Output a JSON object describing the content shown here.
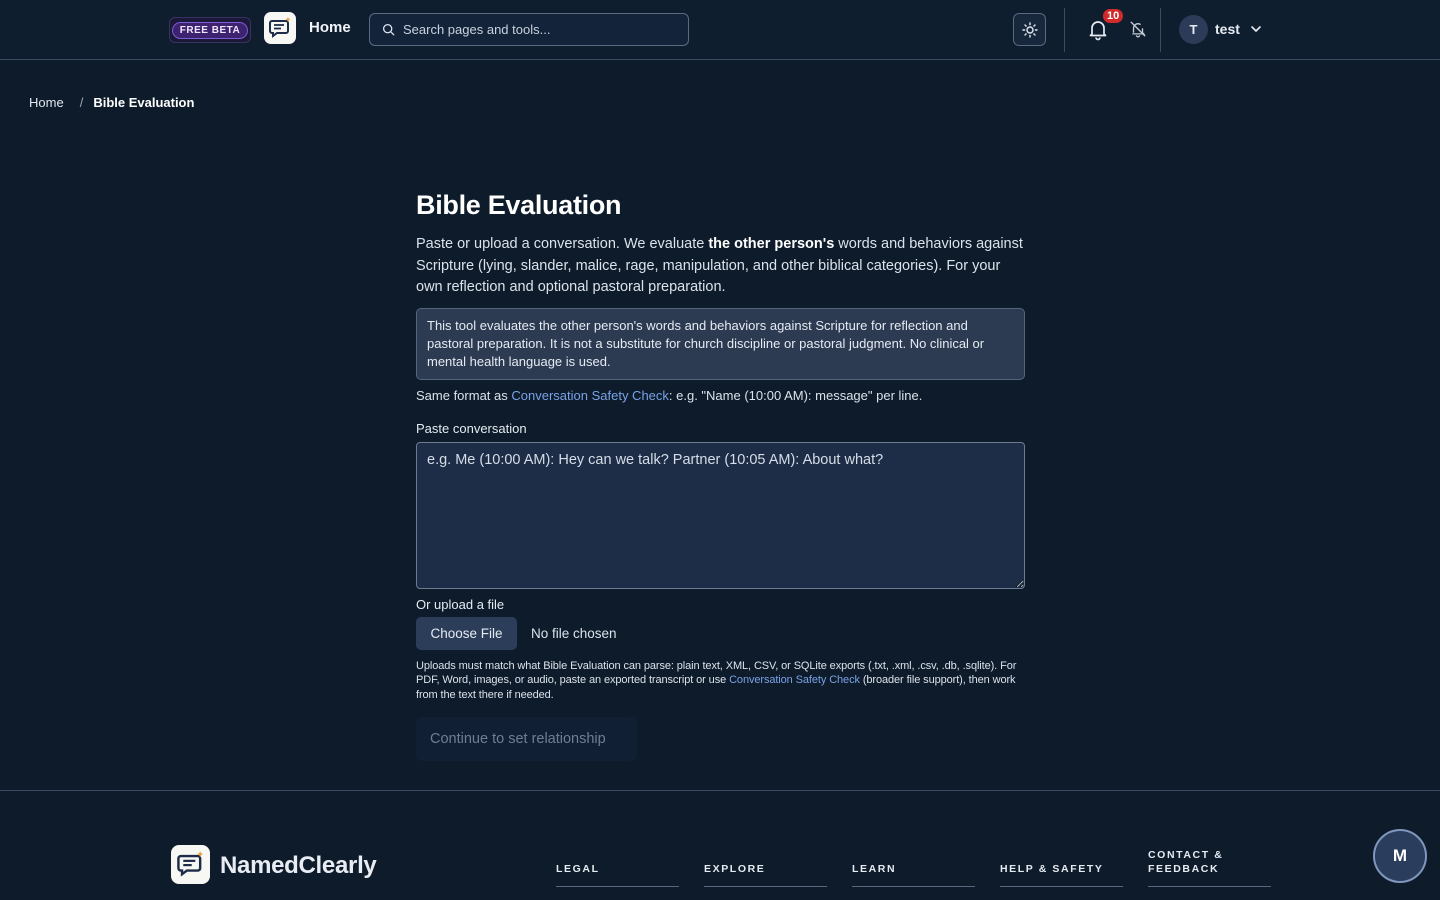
{
  "header": {
    "beta_label": "FREE BETA",
    "home_label": "Home",
    "search_placeholder": "Search pages and tools...",
    "notification_count": "10",
    "user_initial": "T",
    "user_name": "test"
  },
  "breadcrumb": {
    "home": "Home",
    "separator": "/",
    "current": "Bible Evaluation"
  },
  "main": {
    "title": "Bible Evaluation",
    "intro_part1": "Paste or upload a conversation. We evaluate ",
    "intro_bold": "the other person's",
    "intro_part2": " words and behaviors against Scripture (lying, slander, malice, rage, manipulation, and other biblical categories). For your own reflection and optional pastoral preparation.",
    "notice": "This tool evaluates the other person's words and behaviors against Scripture for reflection and pastoral preparation. It is not a substitute for church discipline or pastoral judgment. No clinical or mental health language is used.",
    "format_prefix": "Same format as ",
    "format_link": "Conversation Safety Check",
    "format_suffix": ": e.g. \"Name (10:00 AM): message\" per line.",
    "paste_label": "Paste conversation",
    "paste_placeholder": "e.g. Me (10:00 AM): Hey can we talk? Partner (10:05 AM): About what?",
    "upload_label": "Or upload a file",
    "choose_file_label": "Choose File",
    "no_file_label": "No file chosen",
    "help_part1": "Uploads must match what Bible Evaluation can parse: plain text, XML, CSV, or SQLite exports (.txt, .xml, .csv, .db, .sqlite). For PDF, Word, images, or audio, paste an exported transcript or use ",
    "help_link": "Conversation Safety Check",
    "help_part2": " (broader file support), then work from the text there if needed.",
    "continue_label": "Continue to set relationship"
  },
  "footer": {
    "brand": "NamedClearly",
    "columns": [
      "LEGAL",
      "EXPLORE",
      "LEARN",
      "HELP & SAFETY",
      "CONTACT & FEEDBACK"
    ]
  },
  "fab_label": "M",
  "colors": {
    "background": "#0d1b2a",
    "link": "#7aa2e6",
    "badge": "#d12a2a",
    "beta": "#3d2270"
  }
}
